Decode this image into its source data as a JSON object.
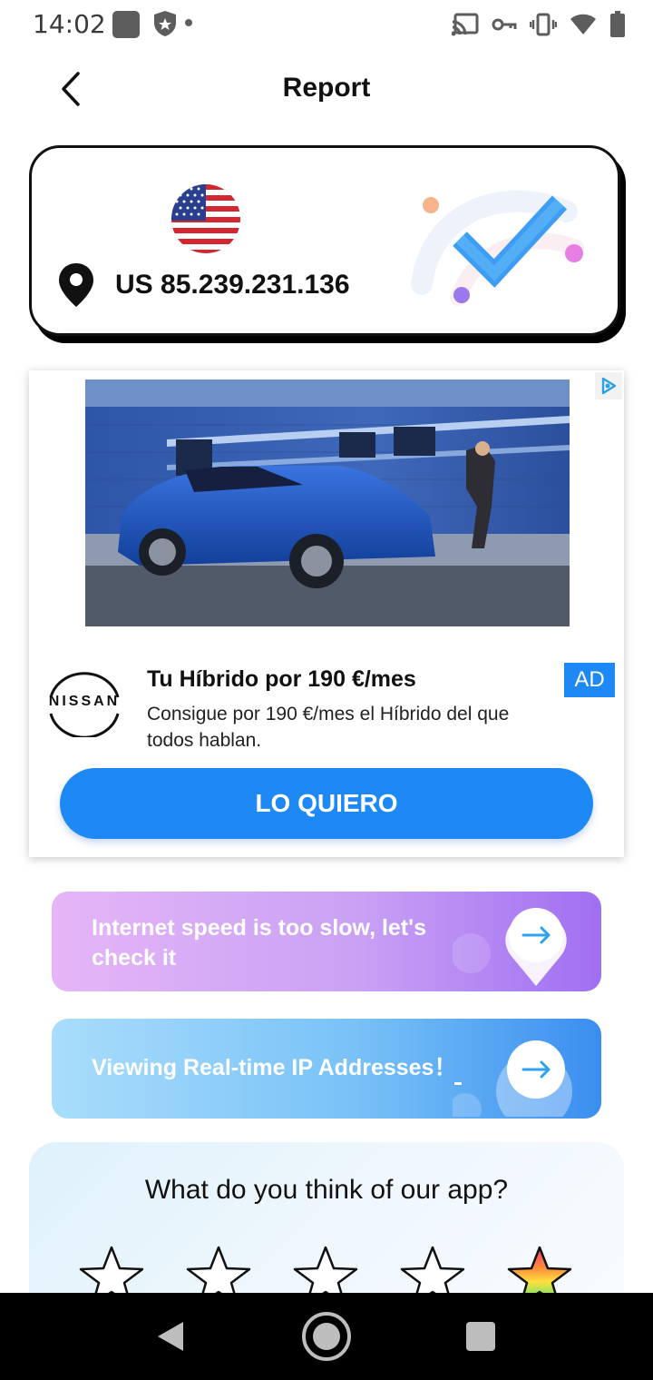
{
  "status_bar": {
    "time": "14:02",
    "icons": [
      "app-notification-icon",
      "shield-icon",
      "dot-icon",
      "cast-icon",
      "vpn-key-icon",
      "vibrate-icon",
      "wifi-icon",
      "battery-icon"
    ]
  },
  "header": {
    "title": "Report",
    "back_icon": "chevron-left-icon"
  },
  "ip_card": {
    "country_flag": "us-flag-icon",
    "location_icon": "location-pin-icon",
    "ip_label": "US 85.239.231.136",
    "status_icon": "check-mark-icon"
  },
  "ad": {
    "advertiser_logo": "NISSAN",
    "title": "Tu Híbrido por 190 €/mes",
    "description": "Consigue por 190 €/mes el Híbrido del que todos hablan.",
    "badge": "AD",
    "cta": "LO QUIERO",
    "adchoices_icon": "adchoices-icon"
  },
  "promos": [
    {
      "text": "Internet speed is too slow, let's check it",
      "icon": "arrow-right-icon"
    },
    {
      "text": "Viewing Real-time IP Addresses！",
      "icon": "arrow-right-icon"
    }
  ],
  "rating": {
    "question": "What do you think of our app?",
    "stars_total": 5,
    "highlighted_star": 5
  },
  "nav_bar": {
    "icons": [
      "nav-back-icon",
      "nav-home-icon",
      "nav-recents-icon"
    ]
  },
  "colors": {
    "accent_blue": "#1e88f5",
    "promo_purple": "#a06ff2",
    "promo_blue": "#3a8ef0"
  }
}
